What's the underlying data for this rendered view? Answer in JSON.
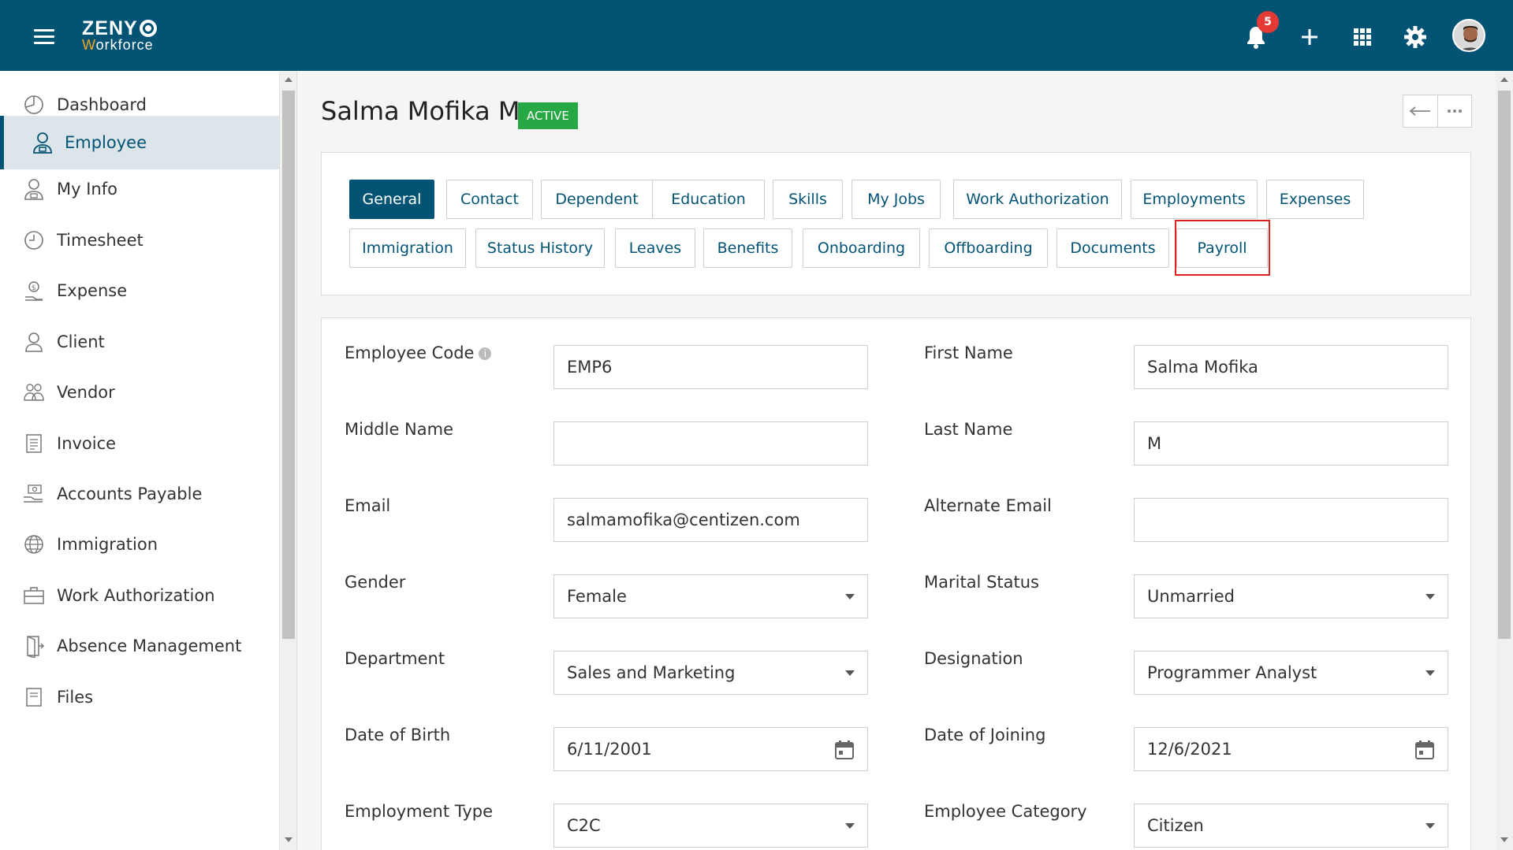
{
  "app": {
    "logo_top": "ZENY",
    "logo_bottom_w": "W",
    "logo_bottom_rest": "orkforce",
    "notification_count": "5"
  },
  "sidebar": {
    "items": [
      {
        "label": "Dashboard",
        "icon": "dashboard-icon"
      },
      {
        "label": "Employee",
        "icon": "employee-icon",
        "active": true
      },
      {
        "label": "My Info",
        "icon": "my-info-icon"
      },
      {
        "label": "Timesheet",
        "icon": "clock-icon"
      },
      {
        "label": "Expense",
        "icon": "expense-icon"
      },
      {
        "label": "Client",
        "icon": "client-icon"
      },
      {
        "label": "Vendor",
        "icon": "vendor-icon"
      },
      {
        "label": "Invoice",
        "icon": "invoice-icon"
      },
      {
        "label": "Accounts Payable",
        "icon": "accounts-payable-icon"
      },
      {
        "label": "Immigration",
        "icon": "globe-icon"
      },
      {
        "label": "Work Authorization",
        "icon": "briefcase-icon"
      },
      {
        "label": "Absence Management",
        "icon": "door-exit-icon"
      },
      {
        "label": "Files",
        "icon": "files-icon"
      }
    ]
  },
  "page": {
    "title": "Salma Mofika M",
    "status": "ACTIVE"
  },
  "tabs": {
    "row1": [
      "General",
      "Contact",
      "Dependent",
      "Education",
      "Skills",
      "My Jobs",
      "Work Authorization",
      "Employments",
      "Expenses"
    ],
    "row2": [
      "Immigration",
      "Status History",
      "Leaves",
      "Benefits",
      "Onboarding",
      "Offboarding",
      "Documents",
      "Payroll"
    ],
    "active": "General",
    "highlighted": "Payroll"
  },
  "form": {
    "employee_code_label": "Employee Code",
    "employee_code": "EMP6",
    "first_name_label": "First Name",
    "first_name": "Salma Mofika",
    "middle_name_label": "Middle Name",
    "middle_name": "",
    "last_name_label": "Last Name",
    "last_name": "M",
    "email_label": "Email",
    "email": "salmamofika@centizen.com",
    "alt_email_label": "Alternate Email",
    "alt_email": "",
    "gender_label": "Gender",
    "gender": "Female",
    "marital_status_label": "Marital Status",
    "marital_status": "Unmarried",
    "department_label": "Department",
    "department": "Sales and Marketing",
    "designation_label": "Designation",
    "designation": "Programmer Analyst",
    "dob_label": "Date of Birth",
    "dob": "6/11/2001",
    "doj_label": "Date of Joining",
    "doj": "12/6/2021",
    "employment_type_label": "Employment Type",
    "employment_type": "C2C",
    "employee_category_label": "Employee Category",
    "employee_category": "Citizen"
  },
  "colors": {
    "header": "#035375",
    "accent": "#035375",
    "status_green": "#28a745",
    "badge_red": "#e53935",
    "highlight_red": "#e0201e"
  }
}
